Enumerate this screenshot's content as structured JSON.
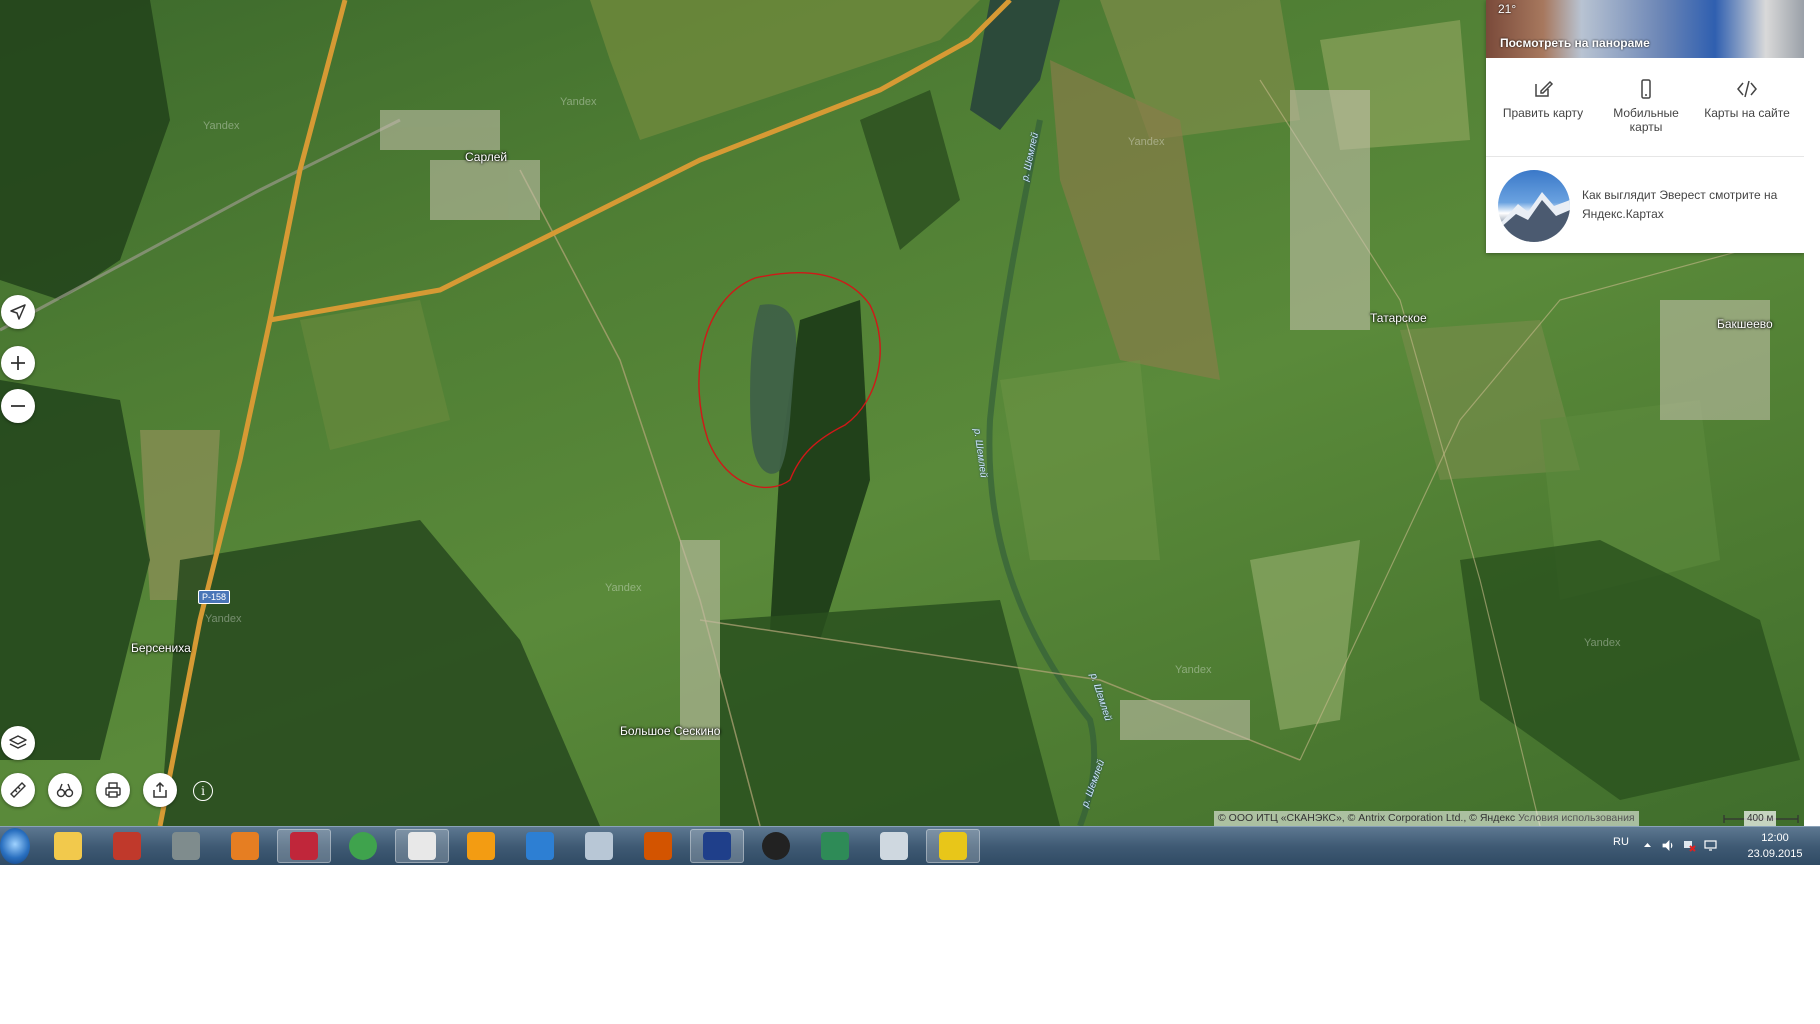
{
  "map": {
    "places": {
      "sarley": "Сарлей",
      "tatarskoe": "Татарское",
      "bakusheevo": "Бакшеево",
      "berseniha": "Берсениха",
      "bolshoe_seskino": "Большое Сескино"
    },
    "rivers": [
      "р. Шемлей",
      "р. Шемлей",
      "р. Шемлей",
      "р. Шемлей"
    ],
    "road_shield": "Р-158",
    "watermark": "Yandex",
    "annotation": "red-circle-around-lake"
  },
  "controls": {
    "geolocation": "locate-icon",
    "zoom_in": "plus-icon",
    "zoom_out": "minus-icon",
    "layers": "layers-icon",
    "ruler": "ruler-icon",
    "panorama": "binoculars-icon",
    "print": "print-icon",
    "share": "share-icon",
    "info": "info-icon"
  },
  "panel": {
    "weather": "21°",
    "panorama_label": "Посмотреть на панораме",
    "tools": [
      {
        "icon": "edit-icon",
        "label": "Править карту"
      },
      {
        "icon": "mobile-icon",
        "label": "Мобильные карты"
      },
      {
        "icon": "code-icon",
        "label": "Карты на сайте"
      }
    ],
    "promo_text": "Как выглядит Эверест смотрите на Яндекс.Картах"
  },
  "copyright": {
    "text": "© ООО ИТЦ «СКАНЭКС», © Antrix Corporation Ltd., © Яндекс",
    "terms": "Условия использования"
  },
  "scale": {
    "label": "400 м"
  },
  "taskbar": {
    "apps": [
      "explorer-icon",
      "pdf-reader-icon",
      "scanner-icon",
      "paint-icon",
      "huawei-icon",
      "utorrent-icon",
      "yandex-browser-icon",
      "vlc-icon",
      "thunder-icon",
      "calculator-icon",
      "ccleaner-icon",
      "floppy-icon",
      "aimp-icon",
      "money-icon",
      "disc-icon",
      "pdf-tool-icon"
    ],
    "active": [
      4,
      6,
      11,
      15
    ],
    "language": "RU",
    "time": "12:00",
    "date": "23.09.2015"
  },
  "colors": {
    "road": "#e0a03a",
    "annotation": "#d01818",
    "water": "#3f6147"
  }
}
